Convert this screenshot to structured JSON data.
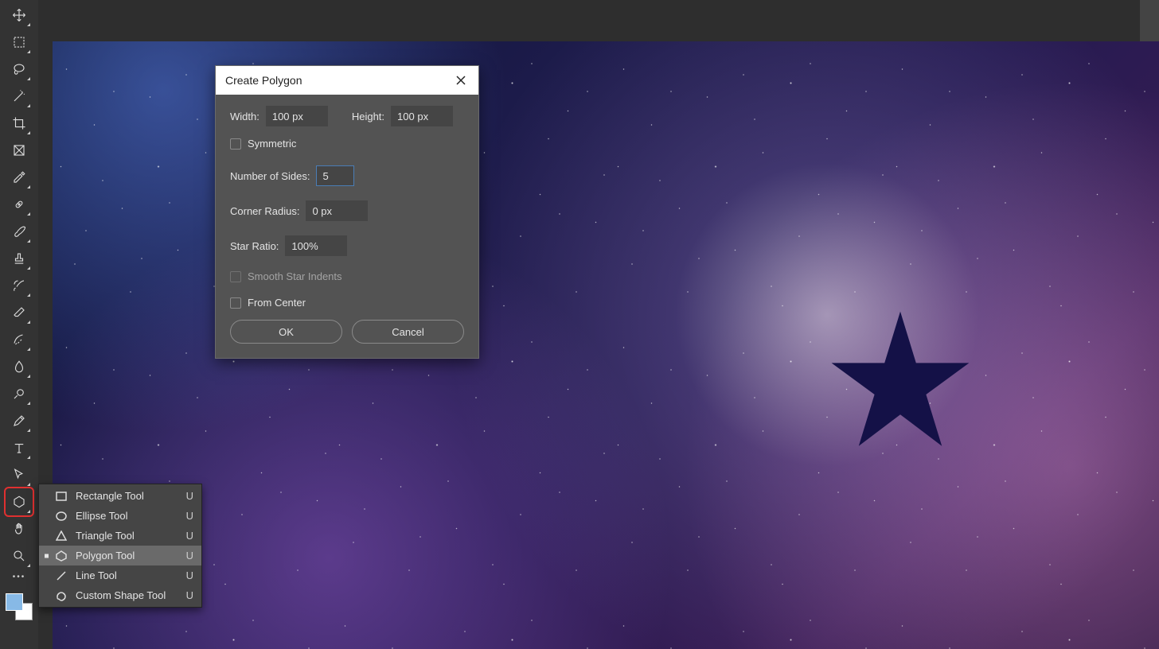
{
  "dialog": {
    "title": "Create Polygon",
    "width_label": "Width:",
    "width_value": "100 px",
    "height_label": "Height:",
    "height_value": "100 px",
    "symmetric_label": "Symmetric",
    "sides_label": "Number of Sides:",
    "sides_value": "5",
    "radius_label": "Corner Radius:",
    "radius_value": "0 px",
    "ratio_label": "Star Ratio:",
    "ratio_value": "100%",
    "smooth_label": "Smooth Star Indents",
    "center_label": "From Center",
    "ok": "OK",
    "cancel": "Cancel"
  },
  "flyout": {
    "items": [
      {
        "label": "Rectangle Tool",
        "key": "U"
      },
      {
        "label": "Ellipse Tool",
        "key": "U"
      },
      {
        "label": "Triangle Tool",
        "key": "U"
      },
      {
        "label": "Polygon Tool",
        "key": "U"
      },
      {
        "label": "Line Tool",
        "key": "U"
      },
      {
        "label": "Custom Shape Tool",
        "key": "U"
      }
    ]
  }
}
